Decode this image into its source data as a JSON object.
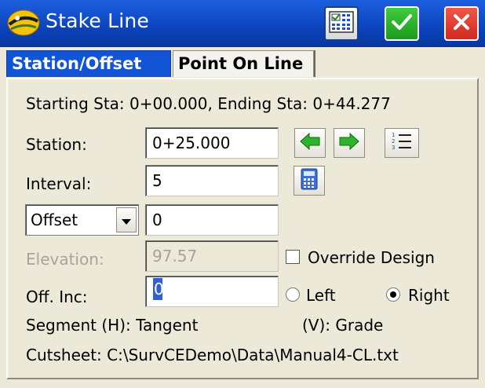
{
  "window": {
    "title": "Stake Line",
    "icons": [
      "app-logo-icon",
      "calculator-icon",
      "checkmark-icon",
      "close-icon"
    ],
    "colors": {
      "titlebar": "#0A3FB5",
      "ok": "#1C9A1C",
      "cancel": "#D22A1F",
      "active_tab": "#1154D6"
    }
  },
  "tabs": [
    {
      "label": "Station/Offset",
      "active": true
    },
    {
      "label": "Point On Line",
      "active": false
    }
  ],
  "form": {
    "range_text": "Starting Sta: 0+00.000, Ending Sta: 0+44.277",
    "station": {
      "label": "Station:",
      "value": "0+25.000"
    },
    "interval": {
      "label": "Interval:",
      "value": "5"
    },
    "offset": {
      "select_value": "Offset",
      "value": "0"
    },
    "elevation": {
      "label": "Elevation:",
      "value": "97.57"
    },
    "override_design": {
      "label": "Override Design",
      "checked": false
    },
    "off_inc": {
      "label": "Off. Inc:",
      "value": "0"
    },
    "side": {
      "left_label": "Left",
      "right_label": "Right",
      "selected": "Right"
    },
    "segment_h": "Segment (H): Tangent",
    "segment_v": "(V): Grade",
    "cutsheet": "Cutsheet: C:\\SurvCEDemo\\Data\\Manual4-CL.txt"
  }
}
